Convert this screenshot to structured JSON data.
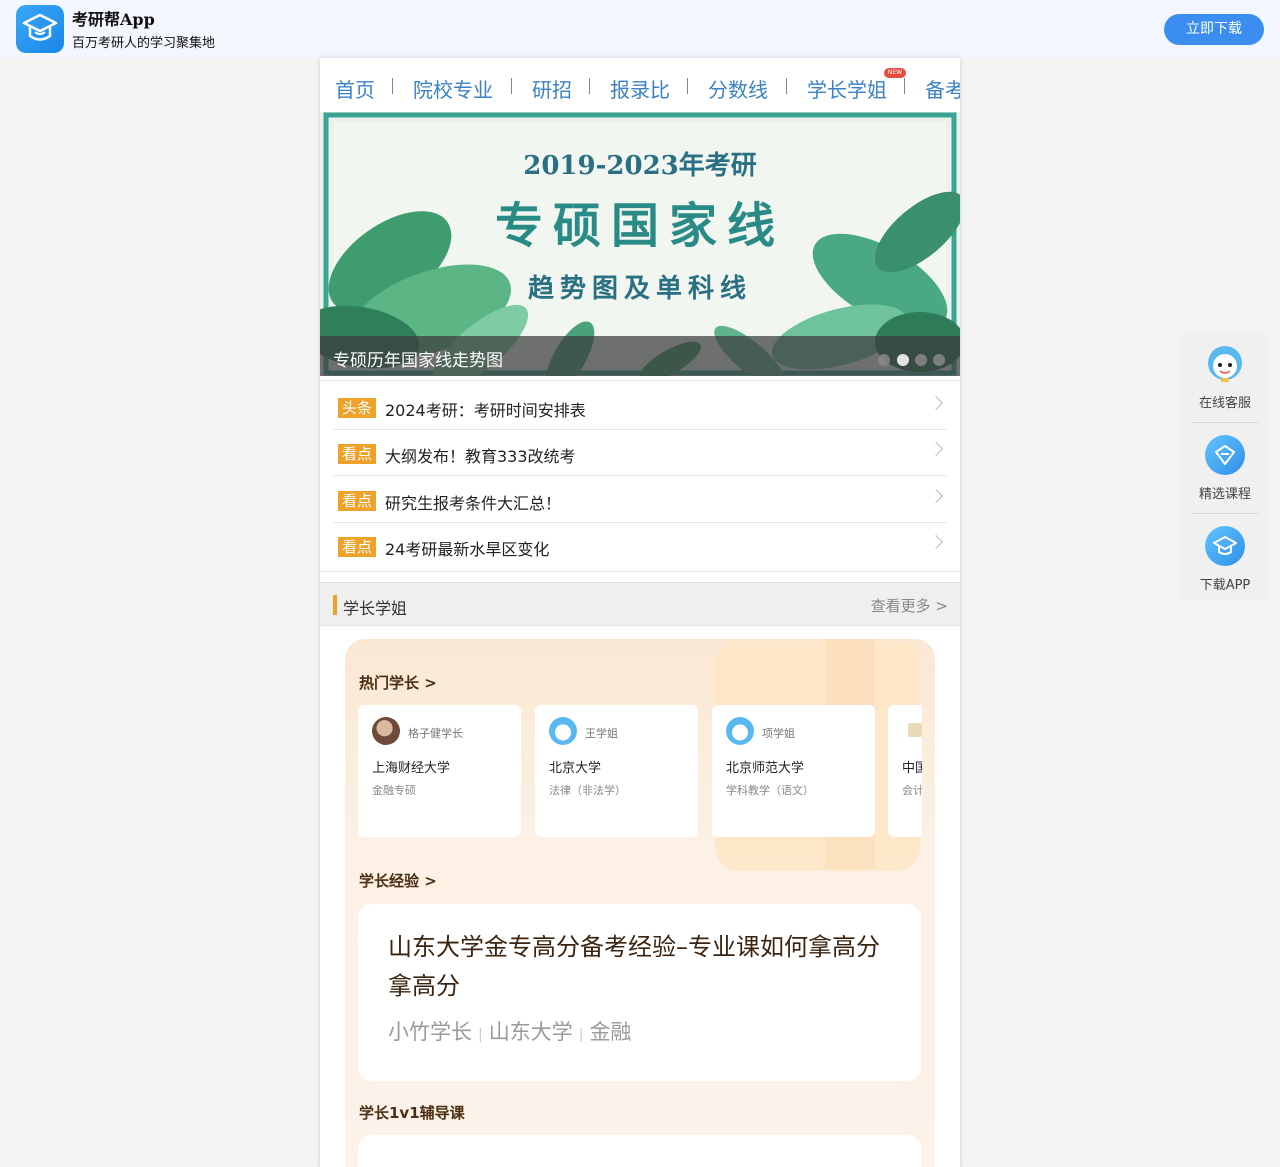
{
  "header": {
    "app_title": "考研帮App",
    "slogan": "百万考研人的学习聚集地",
    "download_label": "立即下载",
    "icon": "graduation-cap-icon"
  },
  "nav": {
    "items": [
      "首页",
      "院校专业",
      "研招",
      "报录比",
      "分数线",
      "学长学姐",
      "备考"
    ],
    "new_badge": "NEW"
  },
  "banner": {
    "year_line": "2019-2023年考研",
    "main_line": "专硕国家线",
    "sub_line": "趋势图及单科线",
    "caption": "专硕历年国家线走势图",
    "dot_count": 4,
    "active_dot": 2
  },
  "news": [
    {
      "tag": "头条",
      "text": "2024考研：考研时间安排表"
    },
    {
      "tag": "看点",
      "text": "大纲发布！教育333改统考"
    },
    {
      "tag": "看点",
      "text": "研究生报考条件大汇总！"
    },
    {
      "tag": "看点",
      "text": "24考研最新水旱区变化"
    }
  ],
  "section": {
    "title": "学长学姐",
    "more": "查看更多 >"
  },
  "hot": {
    "title": "热门学长 >",
    "mentors": [
      {
        "name": "格子健学长",
        "school": "上海财经大学",
        "major": "金融专硕"
      },
      {
        "name": "王学姐",
        "school": "北京大学",
        "major": "法律（非法学）"
      },
      {
        "name": "项学姐",
        "school": "北京师范大学",
        "major": "学科教学（语文）"
      },
      {
        "name": "",
        "school": "中国",
        "major": "会计"
      }
    ]
  },
  "experience": {
    "title": "学长经验 >",
    "article_title": "山东大学金专高分备考经验–专业课如何拿高分拿高分",
    "author": "小竹学长",
    "school": "山东大学",
    "major": "金融"
  },
  "course": {
    "title": "学长1v1辅导课"
  },
  "side": [
    {
      "label": "在线客服",
      "icon": "customer-service-icon"
    },
    {
      "label": "精选课程",
      "icon": "course-icon"
    },
    {
      "label": "下载APP",
      "icon": "download-app-icon"
    }
  ],
  "colors": {
    "accent_blue": "#3b8ef0",
    "nav_blue": "#3b82c4",
    "tag_orange": "#efa22a",
    "banner_green": "#2a9a8a"
  }
}
